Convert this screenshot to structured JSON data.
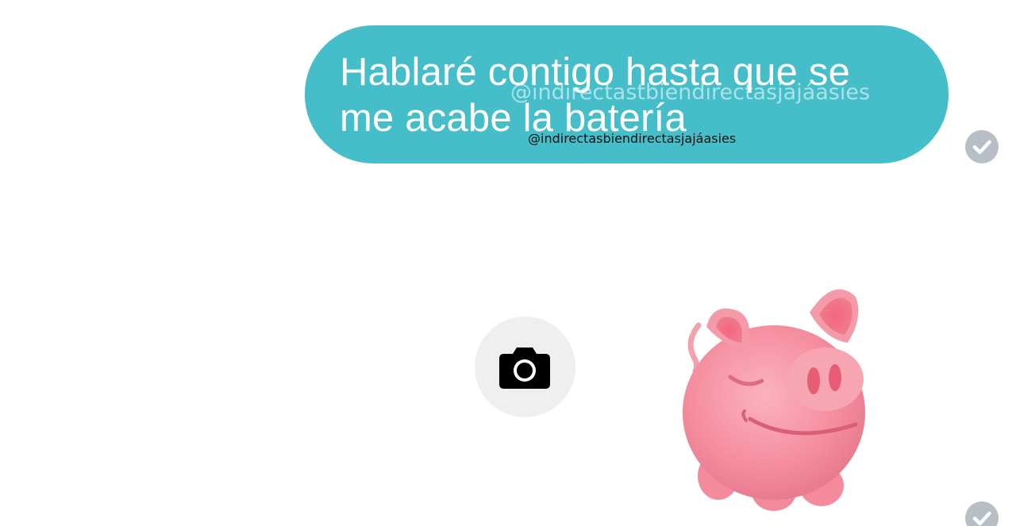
{
  "message": {
    "text": "Hablaré contigo hasta que se me acabe la batería",
    "bubble_color": "#45bec9",
    "status_icon": "check-circle-icon"
  },
  "watermarks": {
    "overlay": "@indirectastbiendirectasjajáasies",
    "caption": "@indirectasbiendirectasjajáasies"
  },
  "camera": {
    "icon": "camera-icon"
  },
  "sticker": {
    "description_icon": "pig-sticker-icon",
    "status_icon": "check-circle-icon"
  }
}
